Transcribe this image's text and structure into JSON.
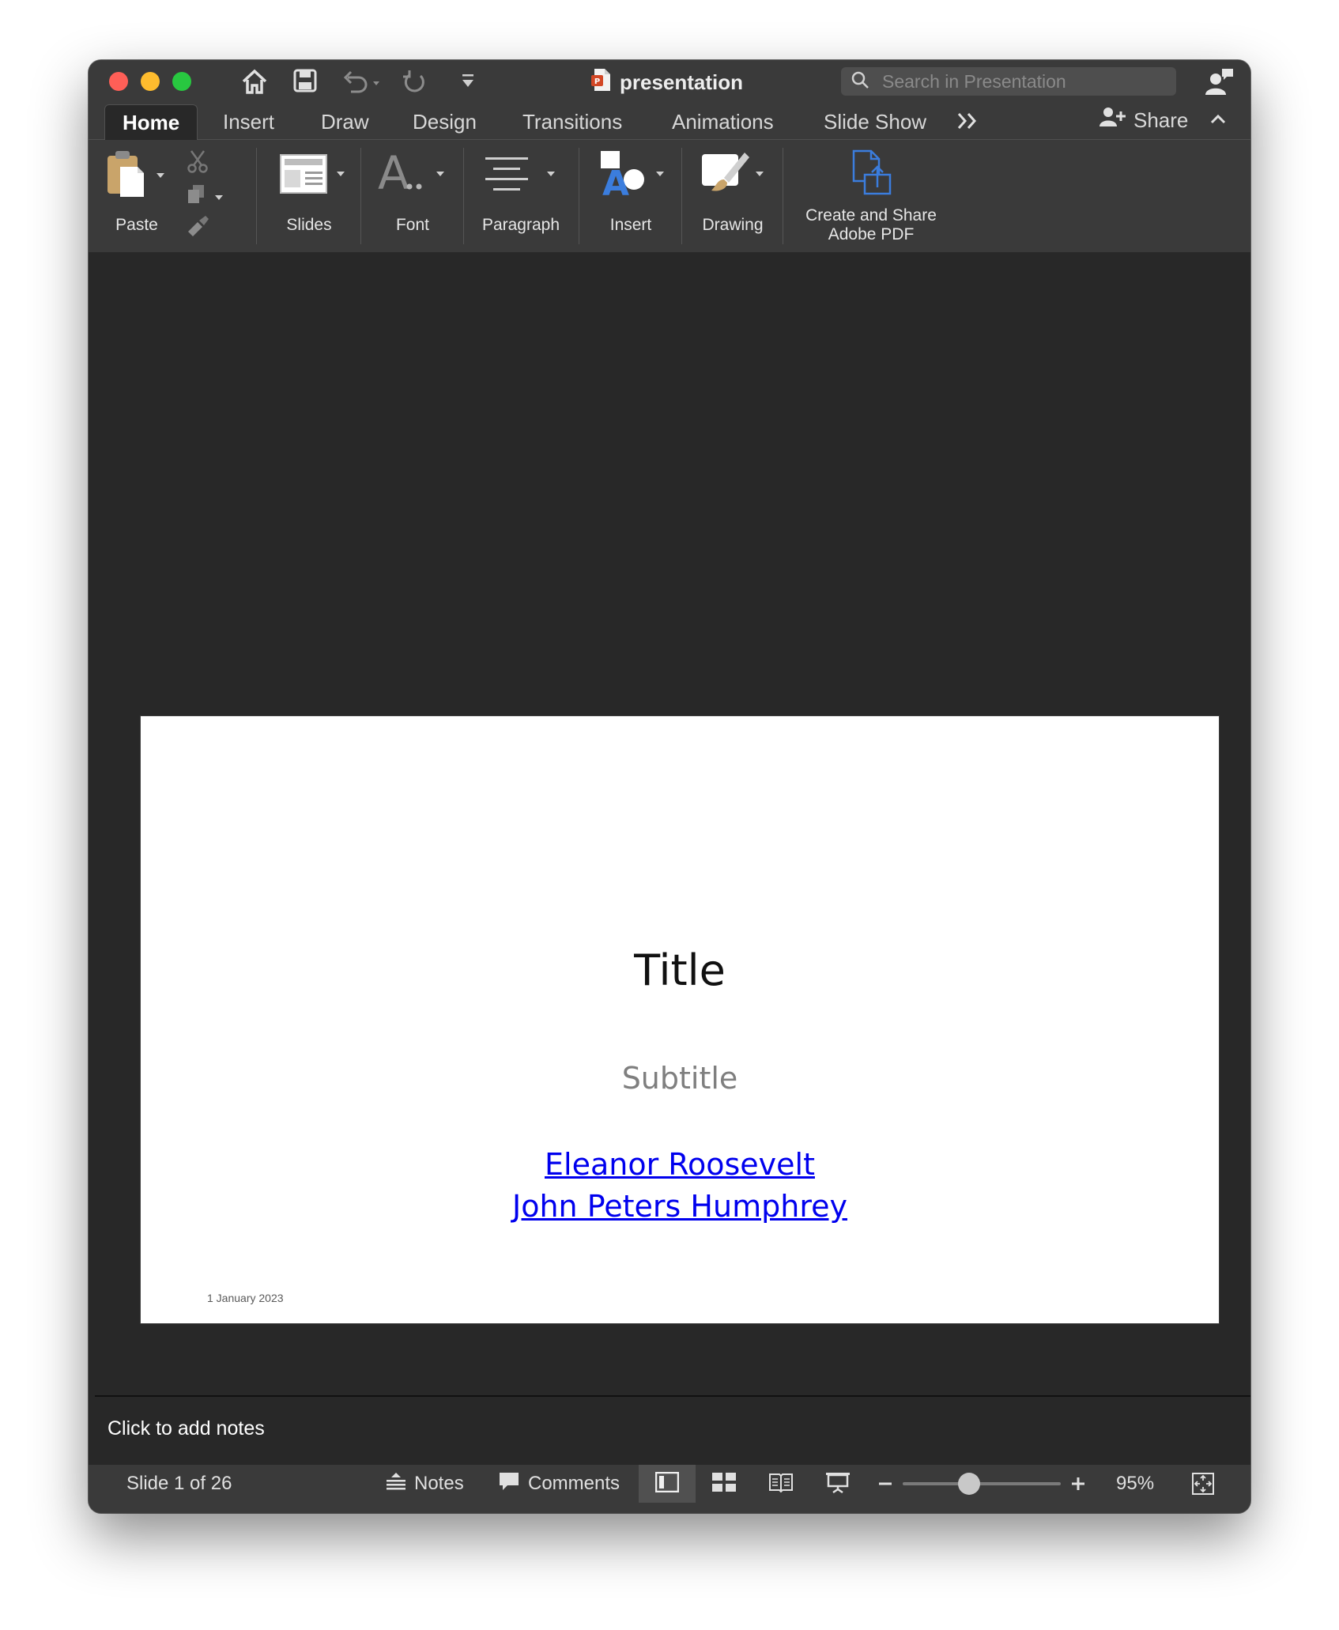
{
  "window": {
    "title": "presentation",
    "search_placeholder": "Search in Presentation"
  },
  "tabs": [
    {
      "label": "Home",
      "active": true
    },
    {
      "label": "Insert"
    },
    {
      "label": "Draw"
    },
    {
      "label": "Design"
    },
    {
      "label": "Transitions"
    },
    {
      "label": "Animations"
    },
    {
      "label": "Slide Show"
    }
  ],
  "share_label": "Share",
  "ribbon": {
    "paste": "Paste",
    "slides": "Slides",
    "font": "Font",
    "paragraph": "Paragraph",
    "insert": "Insert",
    "drawing": "Drawing",
    "adobe_line1": "Create and Share",
    "adobe_line2": "Adobe PDF"
  },
  "slide": {
    "title": "Title",
    "subtitle": "Subtitle",
    "authors": [
      "Eleanor Roosevelt",
      "John Peters Humphrey"
    ],
    "date": "1 January 2023"
  },
  "notes_placeholder": "Click to add notes",
  "status": {
    "slide_info": "Slide 1 of 26",
    "notes": "Notes",
    "comments": "Comments",
    "zoom": "95%",
    "zoom_fraction": 0.42
  },
  "colors": {
    "accent_link": "#0000ee",
    "pdf_icon": "#3b7ddd",
    "window_bg": "#282828"
  }
}
